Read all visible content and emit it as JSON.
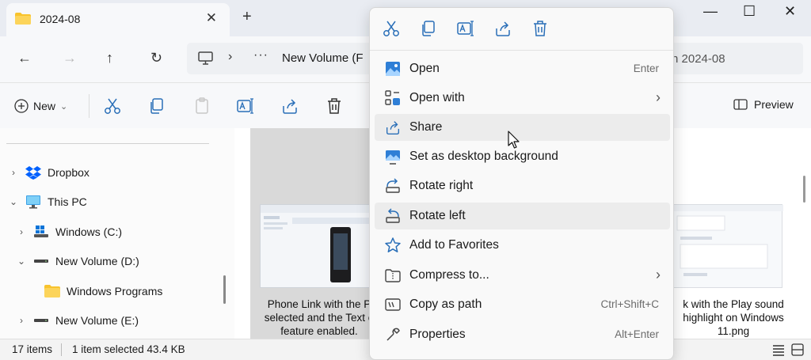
{
  "tab": {
    "title": "2024-08",
    "close_glyph": "✕"
  },
  "new_tab_glyph": "+",
  "window_controls": {
    "minimize": "—",
    "maximize": "☐",
    "close": "✕"
  },
  "nav": {
    "back": "←",
    "forward": "→",
    "up": "↑",
    "refresh": "↻"
  },
  "address": {
    "chevron": "›",
    "ellipsis": "···",
    "path_text": "New Volume (F"
  },
  "search": {
    "placeholder_visible": "h 2024-08"
  },
  "toolbar": {
    "new_label": "New",
    "new_chevron": "⌄",
    "preview_label": "Preview"
  },
  "sidebar": {
    "items": [
      {
        "label": "Dropbox",
        "chevron": "›",
        "icon": "dropbox-icon"
      },
      {
        "label": "This PC",
        "chevron": "⌄",
        "icon": "pc-icon"
      },
      {
        "label": "Windows (C:)",
        "chevron": "›",
        "icon": "windows-drive-icon"
      },
      {
        "label": "New Volume (D:)",
        "chevron": "⌄",
        "icon": "drive-icon"
      },
      {
        "label": "Windows Programs",
        "chevron": "",
        "icon": "folder-icon"
      },
      {
        "label": "New Volume (E:)",
        "chevron": "›",
        "icon": "drive-icon"
      }
    ]
  },
  "files": [
    {
      "caption_lines": [
        "Phone Link with the P",
        "selected and the Text e",
        "feature enabled."
      ]
    },
    {
      "caption_lines": [
        "k with the Play sound",
        "highlight on Windows",
        "11.png"
      ]
    }
  ],
  "status": {
    "item_count": "17 items",
    "selection": "1 item selected  43.4 KB"
  },
  "context_menu": {
    "top_actions": [
      "cut-icon",
      "copy-icon",
      "rename-icon",
      "share-icon",
      "delete-icon"
    ],
    "items": [
      {
        "label": "Open",
        "shortcut": "Enter",
        "submenu": "",
        "icon": "image-open-icon"
      },
      {
        "label": "Open with",
        "shortcut": "",
        "submenu": "›",
        "icon": "open-with-icon"
      },
      {
        "label": "Share",
        "shortcut": "",
        "submenu": "",
        "icon": "share-icon"
      },
      {
        "label": "Set as desktop background",
        "shortcut": "",
        "submenu": "",
        "icon": "desktop-background-icon"
      },
      {
        "label": "Rotate right",
        "shortcut": "",
        "submenu": "",
        "icon": "rotate-right-icon"
      },
      {
        "label": "Rotate left",
        "shortcut": "",
        "submenu": "",
        "icon": "rotate-left-icon"
      },
      {
        "label": "Add to Favorites",
        "shortcut": "",
        "submenu": "",
        "icon": "star-icon"
      },
      {
        "label": "Compress to...",
        "shortcut": "",
        "submenu": "›",
        "icon": "compress-icon"
      },
      {
        "label": "Copy as path",
        "shortcut": "Ctrl+Shift+C",
        "submenu": "",
        "icon": "copy-path-icon"
      },
      {
        "label": "Properties",
        "shortcut": "Alt+Enter",
        "submenu": "",
        "icon": "properties-icon"
      }
    ]
  },
  "colors": {
    "accent": "#0067c0",
    "folder": "#f8c32d",
    "hover": "#ececec"
  }
}
